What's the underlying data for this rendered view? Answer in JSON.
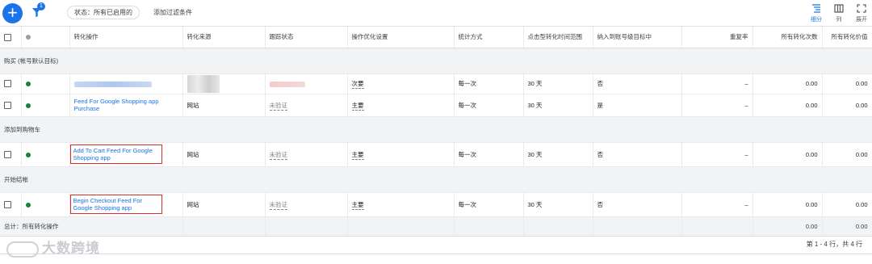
{
  "toolbar": {
    "filter_count": "1",
    "status_chip": "状态：所有已启用的",
    "add_filter": "添加过滤条件",
    "views": [
      {
        "label": "细分",
        "icon": "segment-icon"
      },
      {
        "label": "列",
        "icon": "columns-icon"
      },
      {
        "label": "展开",
        "icon": "expand-icon"
      }
    ]
  },
  "columns": [
    "转化操作",
    "转化来源",
    "跟踪状态",
    "操作优化设置",
    "统计方式",
    "点击型转化时间范围",
    "纳入到账号级目标中",
    "重复率",
    "所有转化次数",
    "所有转化价值"
  ],
  "groups": [
    {
      "label": "购买 (帐号默认目标)",
      "rows": [
        {
          "action": "",
          "source": "",
          "tracking": "",
          "optimization": "次要",
          "count": "每一次",
          "window": "30 天",
          "included": "否",
          "repeat": "–",
          "conversions": "0.00",
          "value": "0.00",
          "redacted": true
        },
        {
          "action": "Feed For Google Shopping app Purchase",
          "source": "网站",
          "tracking": "未验证",
          "optimization": "主要",
          "count": "每一次",
          "window": "30 天",
          "included": "是",
          "repeat": "–",
          "conversions": "0.00",
          "value": "0.00"
        }
      ]
    },
    {
      "label": "添加到购物车",
      "rows": [
        {
          "action": "Add To Cart Feed For Google Shopping app",
          "source": "网站",
          "tracking": "未验证",
          "optimization": "主要",
          "count": "每一次",
          "window": "30 天",
          "included": "否",
          "repeat": "–",
          "conversions": "0.00",
          "value": "0.00",
          "highlight": true
        }
      ]
    },
    {
      "label": "开始结帐",
      "rows": [
        {
          "action": "Begin Checkout Feed For Google Shopping app",
          "source": "网站",
          "tracking": "未验证",
          "optimization": "主要",
          "count": "每一次",
          "window": "30 天",
          "included": "否",
          "repeat": "–",
          "conversions": "0.00",
          "value": "0.00",
          "highlight": true
        }
      ]
    }
  ],
  "total": {
    "label": "总计：所有转化操作",
    "conversions": "0.00",
    "value": "0.00"
  },
  "pagination": "第 1 - 4 行，共 4 行",
  "watermark": "大数跨境",
  "colors": {
    "accent": "#1a73e8",
    "status_green": "#188038",
    "highlight_red": "#d93025"
  }
}
